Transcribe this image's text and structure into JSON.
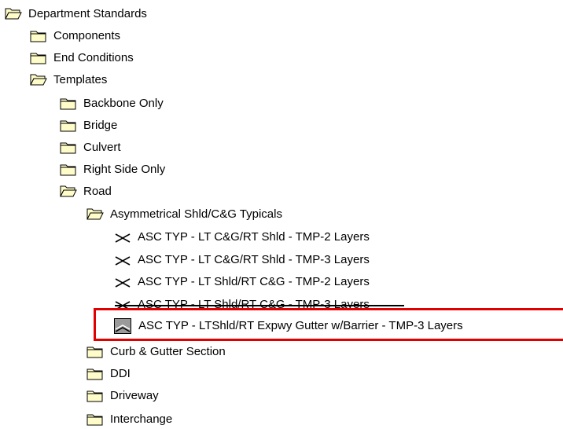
{
  "tree": {
    "items": [
      {
        "label": "Department Standards",
        "icon": "folder-open-icon"
      },
      {
        "label": "Components",
        "icon": "folder-icon"
      },
      {
        "label": "End Conditions",
        "icon": "folder-icon"
      },
      {
        "label": "Templates",
        "icon": "folder-open-icon"
      },
      {
        "label": "Backbone Only",
        "icon": "folder-icon"
      },
      {
        "label": "Bridge",
        "icon": "folder-icon"
      },
      {
        "label": "Culvert",
        "icon": "folder-icon"
      },
      {
        "label": "Right Side Only",
        "icon": "folder-icon"
      },
      {
        "label": "Road",
        "icon": "folder-open-icon"
      },
      {
        "label": "Asymmetrical Shld/C&G Typicals",
        "icon": "folder-open-icon"
      },
      {
        "label": "ASC TYP - LT C&G/RT Shld - TMP-2 Layers",
        "icon": "template-icon"
      },
      {
        "label": "ASC TYP - LT C&G/RT Shld - TMP-3 Layers",
        "icon": "template-icon"
      },
      {
        "label": "ASC TYP - LT Shld/RT C&G - TMP-2 Layers",
        "icon": "template-icon"
      },
      {
        "label": "ASC TYP - LT Shld/RT C&G - TMP-3 Layers",
        "icon": "template-icon"
      },
      {
        "label": "ASC TYP - LTShld/RT Expwy Gutter w/Barrier - TMP-3 Layers",
        "icon": "template-preview-icon"
      },
      {
        "label": "Curb & Gutter Section",
        "icon": "folder-icon"
      },
      {
        "label": "DDI",
        "icon": "folder-icon"
      },
      {
        "label": "Driveway",
        "icon": "folder-icon"
      },
      {
        "label": "Interchange",
        "icon": "folder-icon"
      }
    ]
  },
  "colors": {
    "folder_fill": "#fefcc8",
    "folder_stroke": "#000000",
    "highlight": "#e00000"
  }
}
